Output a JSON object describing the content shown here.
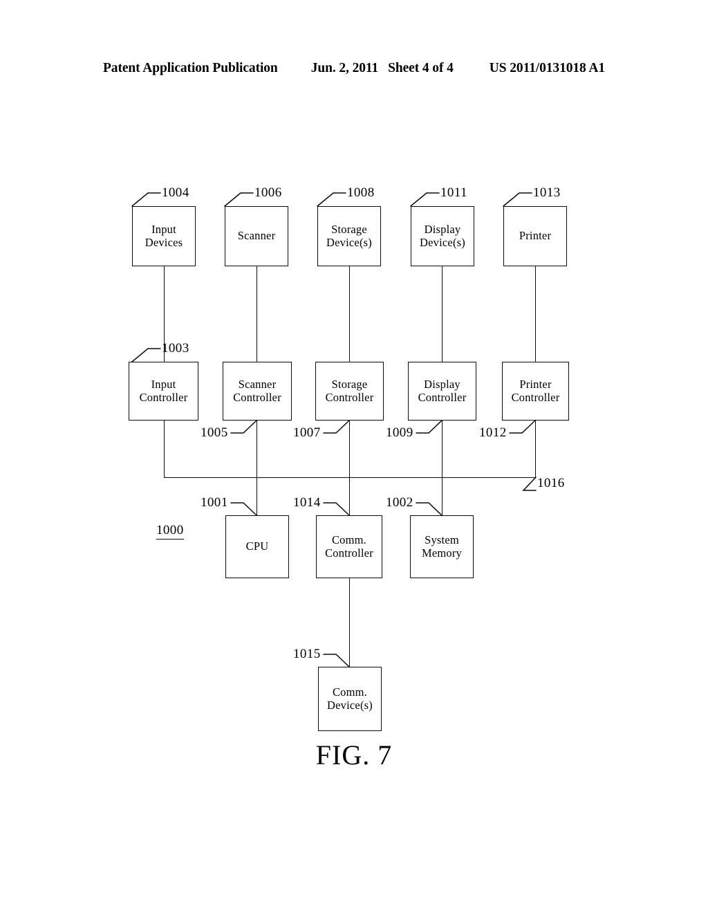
{
  "header": {
    "title": "Patent Application Publication",
    "date": "Jun. 2, 2011",
    "sheet": "Sheet 4 of 4",
    "number": "US 2011/0131018 A1"
  },
  "figure": {
    "caption": "FIG. 7",
    "system_ref": "1000",
    "bus_ref": "1016"
  },
  "nodes": {
    "input_devices": {
      "label": "Input\nDevices",
      "ref": "1004"
    },
    "scanner": {
      "label": "Scanner",
      "ref": "1006"
    },
    "storage_devices": {
      "label": "Storage\nDevice(s)",
      "ref": "1008"
    },
    "display_devices": {
      "label": "Display\nDevice(s)",
      "ref": "1011"
    },
    "printer": {
      "label": "Printer",
      "ref": "1013"
    },
    "input_controller": {
      "label": "Input\nController",
      "ref": "1003"
    },
    "scanner_controller": {
      "label": "Scanner\nController",
      "ref": "1005"
    },
    "storage_controller": {
      "label": "Storage\nController",
      "ref": "1007"
    },
    "display_controller": {
      "label": "Display\nController",
      "ref": "1009"
    },
    "printer_controller": {
      "label": "Printer\nController",
      "ref": "1012"
    },
    "cpu": {
      "label": "CPU",
      "ref": "1001"
    },
    "comm_controller": {
      "label": "Comm.\nController",
      "ref": "1014"
    },
    "system_memory": {
      "label": "System\nMemory",
      "ref": "1002"
    },
    "comm_devices": {
      "label": "Comm.\nDevice(s)",
      "ref": "1015"
    }
  },
  "colors": {
    "ink": "#0a0a0a",
    "paper": "#ffffff"
  }
}
